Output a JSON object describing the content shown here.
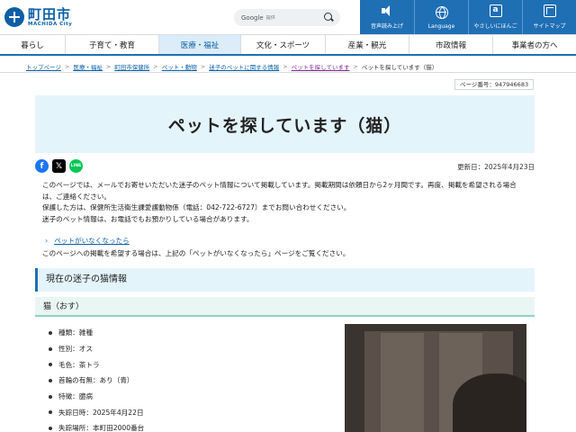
{
  "header": {
    "logo_jp": "町田市",
    "logo_en": "MACHIDA City",
    "search_google": "Google",
    "search_placeholder": "提供",
    "utilities": [
      {
        "label": "音声読み上げ",
        "icon": "speaker-icon"
      },
      {
        "label": "Language",
        "icon": "globe-icon"
      },
      {
        "label": "やさしいにほんご",
        "icon": "easy-japanese-icon"
      },
      {
        "label": "サイトマップ",
        "icon": "sitemap-icon"
      }
    ],
    "accent": "#1f6fb5"
  },
  "nav": [
    {
      "label": "暮らし"
    },
    {
      "label": "子育て・教育"
    },
    {
      "label": "医療・福祉",
      "active": true
    },
    {
      "label": "文化・スポーツ"
    },
    {
      "label": "産業・観光"
    },
    {
      "label": "市政情報"
    },
    {
      "label": "事業者の方へ"
    }
  ],
  "breadcrumb": [
    "トップページ",
    "医療・福祉",
    "町田市保健所",
    "ペット・動物",
    "迷子のペットに関する情報",
    "ペットを探しています",
    "ペットを探しています（猫）"
  ],
  "page_number": "ページ番号：947946683",
  "title": "ペットを探しています（猫）",
  "share": {
    "fb": "f",
    "x": "𝕏",
    "line": "LINE"
  },
  "updated": "更新日：2025年4月23日",
  "intro": {
    "line1": "このページでは、メールでお寄せいただいた迷子のペット情報について掲載しています。掲載期間は依頼日から2ヶ月間です。再度、掲載を希望される場合は、ご連絡ください。",
    "line2": "保護した方は、保健所生活衛生課愛護動物係（電話：042-722-6727）までお問い合わせください。",
    "line3": "迷子のペット情報は、お電話でもお預かりしている場合があります。"
  },
  "link": "ペットがいなくなったら",
  "note": "このページへの掲載を希望する場合は、上記の「ペットがいなくなったら」ページをご覧ください。",
  "section_title": "現在の迷子の猫情報",
  "sub_title": "猫（おす）",
  "facts": [
    "種類：雑種",
    "性別：オス",
    "毛色：茶トラ",
    "首輪の有無：あり（青）",
    "特徴：臆病",
    "失踪日時：2025年4月22日",
    "失踪場所：本町田2000番台"
  ]
}
